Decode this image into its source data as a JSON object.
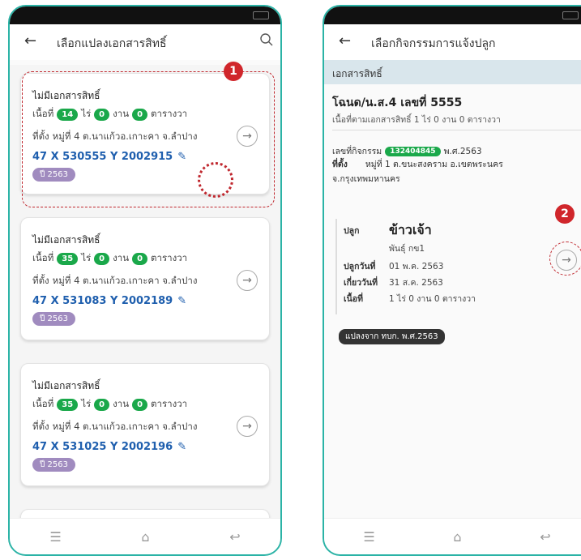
{
  "left": {
    "title": "เลือกแปลงเอกสารสิทธิ์",
    "cards": [
      {
        "doc": "ไม่มีเอกสารสิทธิ์",
        "area_label": "เนื้อที่",
        "rai": "14",
        "rai_unit": "ไร่",
        "ngan": "0",
        "ngan_unit": "งาน",
        "wa": "0",
        "wa_unit": "ตารางวา",
        "loc_label": "ที่ตั้ง",
        "location": "หมู่ที่ 4 ต.นาแก้วอ.เกาะคา จ.ลำปาง",
        "coord": "47 X 530555 Y 2002915",
        "year": "ปี 2563"
      },
      {
        "doc": "ไม่มีเอกสารสิทธิ์",
        "area_label": "เนื้อที่",
        "rai": "35",
        "rai_unit": "ไร่",
        "ngan": "0",
        "ngan_unit": "งาน",
        "wa": "0",
        "wa_unit": "ตารางวา",
        "loc_label": "ที่ตั้ง",
        "location": "หมู่ที่ 4 ต.นาแก้วอ.เกาะคา จ.ลำปาง",
        "coord": "47 X 531083 Y 2002189",
        "year": "ปี 2563"
      },
      {
        "doc": "ไม่มีเอกสารสิทธิ์",
        "area_label": "เนื้อที่",
        "rai": "35",
        "rai_unit": "ไร่",
        "ngan": "0",
        "ngan_unit": "งาน",
        "wa": "0",
        "wa_unit": "ตารางวา",
        "loc_label": "ที่ตั้ง",
        "location": "หมู่ที่ 4 ต.นาแก้วอ.เกาะคา จ.ลำปาง",
        "coord": "47 X 531025 Y 2002196",
        "year": "ปี 2563"
      }
    ],
    "badge": "1"
  },
  "right": {
    "title": "เลือกกิจกรรมการแจ้งปลูก",
    "section": "เอกสารสิทธิ์",
    "deed_title": "โฉนด/น.ส.4 เลขที่ 5555",
    "deed_sub": "เนื้อที่ตามเอกสารสิทธิ์ 1 ไร่ 0 งาน 0 ตารางวา",
    "activity_label": "เลขที่กิจกรรม",
    "activity_no": "132404845",
    "activity_year": "พ.ศ.2563",
    "loc_label": "ที่ตั้ง",
    "location": "หมู่ที่ 1 ต.ขนะสงคราม อ.เขตพระนคร",
    "province": "จ.กรุงเทพมหานคร",
    "plant_label": "ปลูก",
    "crop": "ข้าวเจ้า",
    "variety": "พันธุ์ กข1",
    "plant_date_label": "ปลูกวันที่",
    "plant_date": "01 พ.ค. 2563",
    "harvest_label": "เกี่ยววันที่",
    "harvest_date": "31 ส.ค. 2563",
    "area_label": "เนื้อที่",
    "area": "1 ไร่ 0 งาน 0 ตารางวา",
    "converted": "แปลงจาก ทบก. พ.ศ.2563",
    "badge": "2"
  },
  "colors": {
    "frame": "#2bb3a6",
    "accent_green": "#1aa84a",
    "coord_blue": "#1f5fae",
    "year_purple": "#a08bbf",
    "marker_red": "#d0262b"
  }
}
